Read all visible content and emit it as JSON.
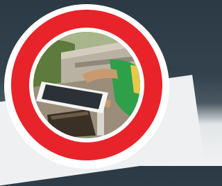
{
  "image": {
    "subject": "",
    "colors": {
      "ring_red": "#e8232a",
      "ring_white": "#ffffff",
      "background_dark": "#2b3a45",
      "background_light": "#eef0f1",
      "shirt_green": "#2fa04a",
      "tablet_white": "#f4f4f4",
      "screen_dark": "#2c3138",
      "ground": "#9b8d7a",
      "foliage": "#6f8a4a"
    }
  }
}
